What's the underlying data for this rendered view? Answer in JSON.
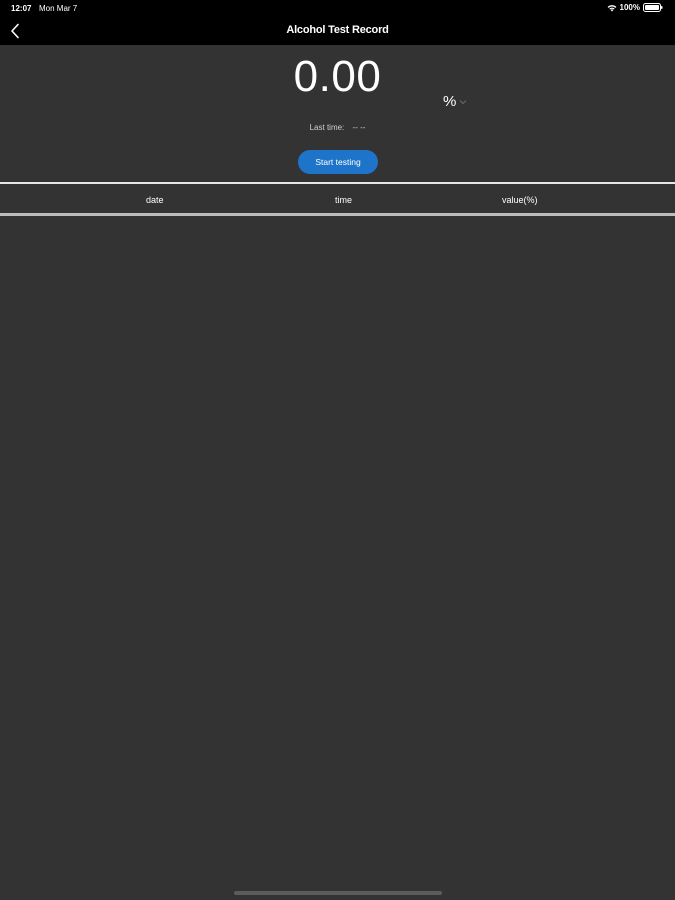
{
  "status_bar": {
    "time": "12:07",
    "date": "Mon Mar 7",
    "battery": "100%"
  },
  "nav": {
    "title": "Alcohol Test Record",
    "back_icon": "chevron-left-icon"
  },
  "reading": {
    "value": "0.00",
    "unit": "%"
  },
  "last_time": {
    "label": "Last time:",
    "value": "-- --"
  },
  "start_button": {
    "label": "Start testing"
  },
  "table": {
    "columns": [
      "date",
      "time",
      "value(%)"
    ],
    "rows": []
  },
  "colors": {
    "background": "#333333",
    "bar": "#000000",
    "accent": "#1e74c9"
  }
}
